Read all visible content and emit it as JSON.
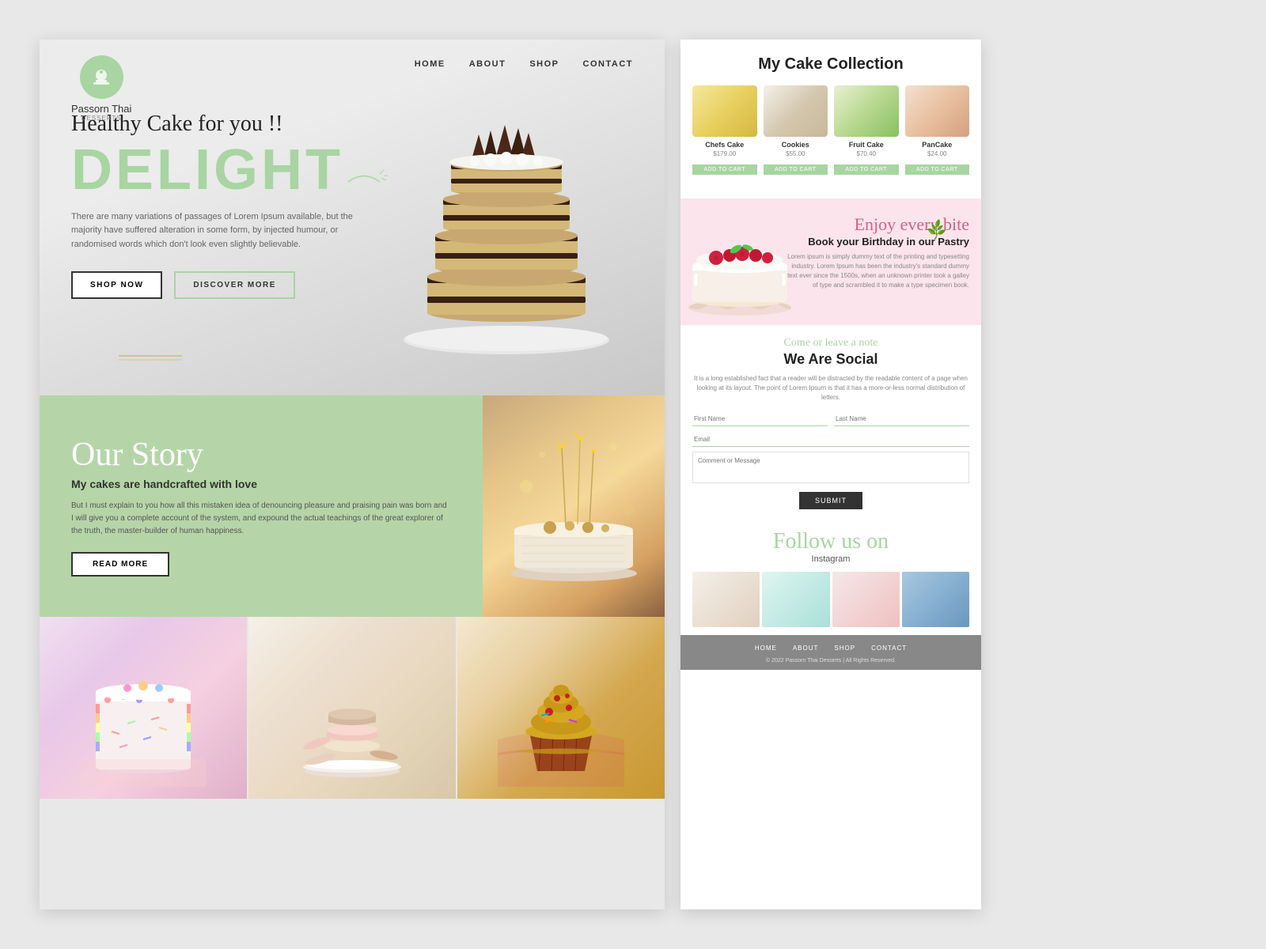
{
  "site": {
    "logo_name": "Passorn Thai",
    "logo_sub": "DESSERTS",
    "nav": {
      "items": [
        {
          "label": "HOME",
          "href": "#"
        },
        {
          "label": "ABOUT",
          "href": "#"
        },
        {
          "label": "SHOP",
          "href": "#"
        },
        {
          "label": "CONTACT",
          "href": "#"
        }
      ]
    }
  },
  "hero": {
    "tagline": "Healthy Cake for you !!",
    "title": "DELIGHT",
    "description": "There are many variations of passages of Lorem Ipsum available, but the majority have suffered alteration in some form, by injected humour, or randomised words which don't look even slightly believable.",
    "btn_shop": "SHOP NOW",
    "btn_discover": "DISCOVER MORE"
  },
  "story": {
    "script_title": "Our Story",
    "subtitle": "My cakes are handcrafted with love",
    "description": "But I must explain to you how all this mistaken idea of denouncing pleasure and praising pain was born and I will give you a complete account of the system, and expound the actual teachings of the great explorer of the truth, the master-builder of human happiness.",
    "btn_label": "READ MORE"
  },
  "collection": {
    "title": "My Cake Collection",
    "items": [
      {
        "name": "Chefs Cake",
        "price": "$179.00",
        "btn": "ADD TO CART"
      },
      {
        "name": "Cookies",
        "price": "$55.00",
        "btn": "ADD TO CART"
      },
      {
        "name": "Fruit Cake",
        "price": "$70.40",
        "btn": "ADD TO CART"
      },
      {
        "name": "PanCake",
        "price": "$24.00",
        "btn": "ADD TO CART"
      }
    ]
  },
  "birthday": {
    "script": "Enjoy every bite",
    "title": "Book your Birthday in our Pastry",
    "description": "Lorem ipsum is simply dummy text of the printing and typesetting industry. Lorem Ipsum has been the industry's standard dummy text ever since the 1500s, when an unknown printer took a galley of type and scrambled it to make a type specimen book."
  },
  "social": {
    "tagline": "Come or leave a note",
    "title": "We Are Social",
    "description": "It is a long established fact that a reader will be distracted by the readable content of a page when looking at its layout. The point of Lorem Ipsum is that it has a more-or-less normal distribution of letters.",
    "form": {
      "first_name_placeholder": "First Name",
      "last_name_placeholder": "Last Name",
      "email_placeholder": "Email",
      "message_placeholder": "Comment or Message",
      "submit_label": "SUBMIT"
    }
  },
  "follow": {
    "script": "Follow us on",
    "sub": "Instagram"
  },
  "footer": {
    "nav": [
      "HOME",
      "ABOUT",
      "SHOP",
      "CONTACT"
    ],
    "copyright": "© 2022 Passorn Thai Desserts | All Rights Reserved."
  }
}
